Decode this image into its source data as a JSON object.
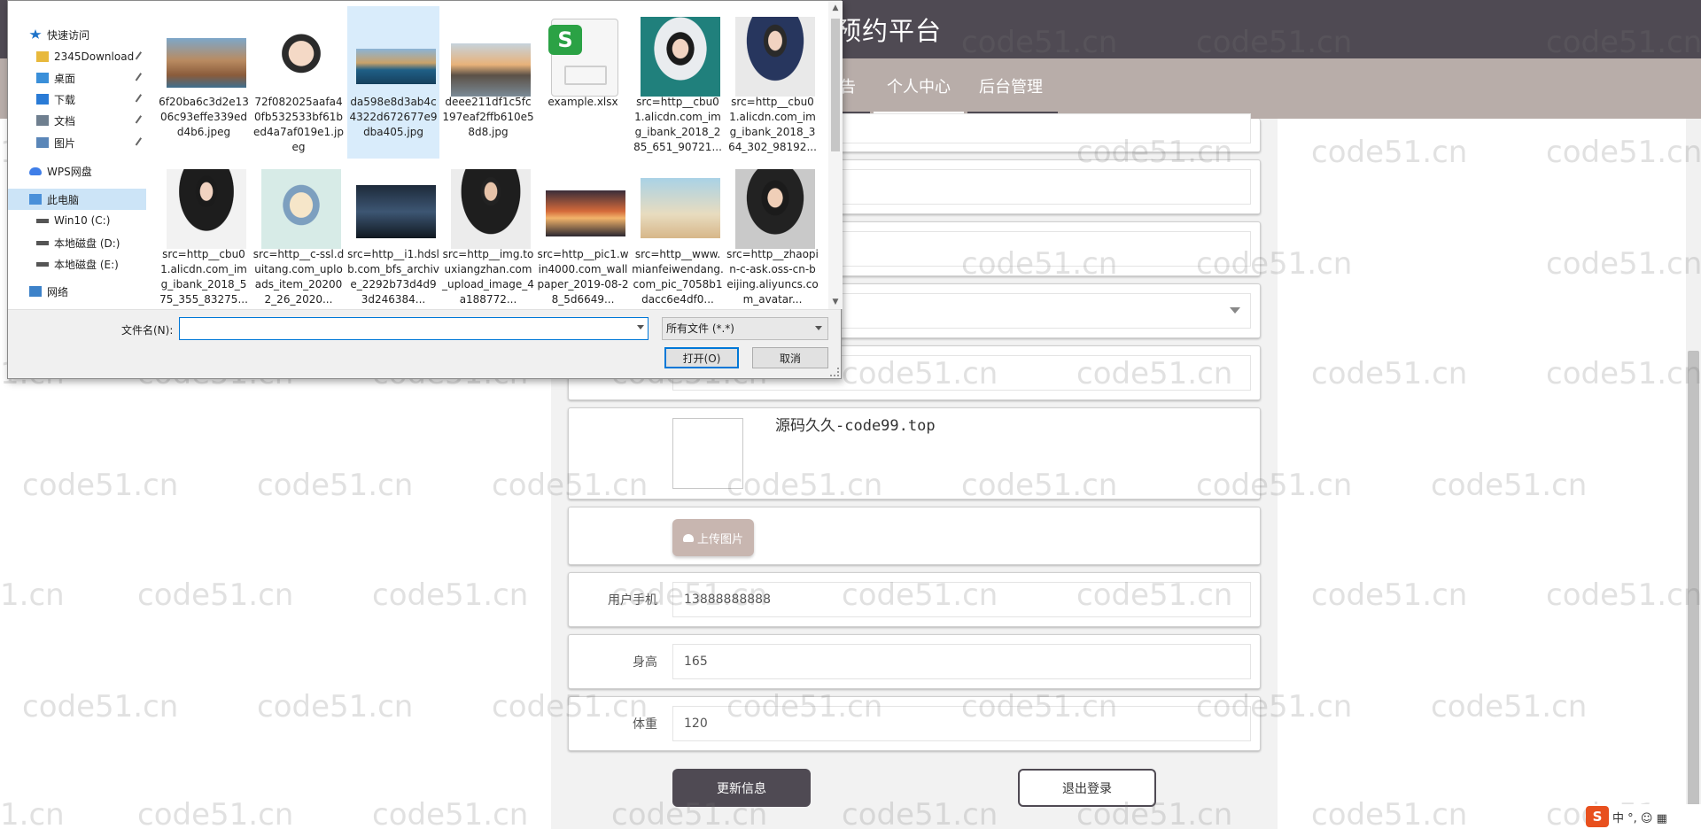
{
  "site": {
    "title_visible": "预约平台",
    "nav": {
      "item_partial": "告",
      "personal_center": "个人中心",
      "admin": "后台管理"
    }
  },
  "profile_form": {
    "image_caption": "源码久久-code99.top",
    "upload_label": "上传图片",
    "phone": {
      "label": "用户手机",
      "value": "13888888888"
    },
    "height": {
      "label": "身高",
      "value": "165"
    },
    "weight": {
      "label": "体重",
      "value": "120"
    },
    "update_button": "更新信息",
    "logout_button": "退出登录"
  },
  "watermark_text": "code51.cn",
  "watermark_edge_text": "1.cn",
  "ime": {
    "logo": "S",
    "text": "中 °, ☺ ▦"
  },
  "dialog": {
    "nav_pane": [
      {
        "label": "快速访问",
        "icon": "star-icon"
      },
      {
        "label": "2345Download",
        "icon": "folder-icon",
        "pinned": true
      },
      {
        "label": "桌面",
        "icon": "desktop-folder-icon",
        "pinned": true
      },
      {
        "label": "下载",
        "icon": "download-arrow-icon",
        "pinned": true
      },
      {
        "label": "文档",
        "icon": "document-icon",
        "pinned": true
      },
      {
        "label": "图片",
        "icon": "pictures-icon",
        "pinned": true
      },
      {
        "label": "WPS网盘",
        "icon": "cloud-icon"
      },
      {
        "label": "此电脑",
        "icon": "computer-icon",
        "selected": true
      },
      {
        "label": "Win10 (C:)",
        "icon": "drive-icon"
      },
      {
        "label": "本地磁盘 (D:)",
        "icon": "drive-icon"
      },
      {
        "label": "本地磁盘 (E:)",
        "icon": "drive-icon"
      },
      {
        "label": "网络",
        "icon": "network-icon"
      }
    ],
    "files": [
      {
        "name": "6f20ba6c3d2e1306c93effe339edd4b6.jpeg",
        "thumb": "coastal-town"
      },
      {
        "name": "72f082025aafa40fb532533bf61bed4a7af019e1.jpeg",
        "thumb": "cartoon-avatar"
      },
      {
        "name": "da598e8d3ab4c4322d672677e9dba405.jpg",
        "thumb": "island-sea",
        "selected": true
      },
      {
        "name": "deee211df1c5fc197eaf2ffb610e58d8.jpg",
        "thumb": "sunset-beach"
      },
      {
        "name": "example.xlsx",
        "thumb": "spreadsheet-icon"
      },
      {
        "name": "src=http__cbu01.alicdn.com_img_ibank_2018_285_651_90721...",
        "thumb": "woman-portrait-teal"
      },
      {
        "name": "src=http__cbu01.alicdn.com_img_ibank_2018_364_302_98192...",
        "thumb": "woman-suit-blue"
      },
      {
        "name": "src=http__cbu01.alicdn.com_img_ibank_2018_575_355_83275...",
        "thumb": "woman-suit-black"
      },
      {
        "name": "src=http__c-ssl.duitang.com_uploads_item_202002_26_2020...",
        "thumb": "cartoon-girl"
      },
      {
        "name": "src=http__i1.hdslb.com_bfs_archive_2292b73d4d93d246384...",
        "thumb": "dancer-dark"
      },
      {
        "name": "src=http__img.touxiangzhan.com_upload_image_4a188772...",
        "thumb": "man-suit"
      },
      {
        "name": "src=http__pic1.win4000.com_wallpaper_2019-08-28_5d6649...",
        "thumb": "sunset-clouds"
      },
      {
        "name": "src=http__www.mianfeiwendang.com_pic_7058b1dacc6e4df0...",
        "thumb": "desert-sky"
      },
      {
        "name": "src=http__zhaopin-c-ask.oss-cn-beijing.aliyuncs.com_avatar...",
        "thumb": "woman-office"
      }
    ],
    "filename_label": "文件名(N):",
    "filename_value": "",
    "filetype": "所有文件 (*.*)",
    "open_button": "打开(O)",
    "cancel_button": "取消"
  }
}
